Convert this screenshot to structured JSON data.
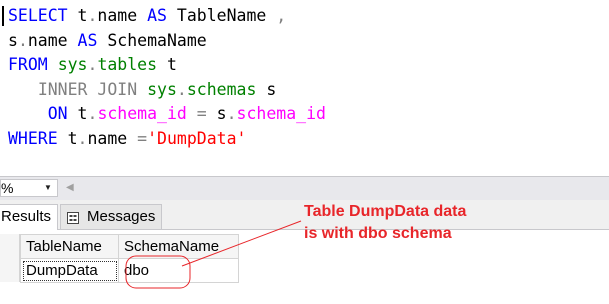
{
  "editor": {
    "lines": [
      [
        {
          "t": "SELECT",
          "c": "kw"
        },
        {
          "t": " t",
          "c": ""
        },
        {
          "t": ".",
          "c": "gr"
        },
        {
          "t": "name ",
          "c": ""
        },
        {
          "t": "AS",
          "c": "kw"
        },
        {
          "t": " TableName ",
          "c": ""
        },
        {
          "t": ",",
          "c": "gr"
        }
      ],
      [
        {
          "t": "s",
          "c": ""
        },
        {
          "t": ".",
          "c": "gr"
        },
        {
          "t": "name ",
          "c": ""
        },
        {
          "t": "AS",
          "c": "kw"
        },
        {
          "t": " SchemaName",
          "c": ""
        }
      ],
      [
        {
          "t": "FROM",
          "c": "kw"
        },
        {
          "t": " ",
          "c": ""
        },
        {
          "t": "sys",
          "c": "sy"
        },
        {
          "t": ".",
          "c": "gr"
        },
        {
          "t": "tables",
          "c": "sy"
        },
        {
          "t": " t",
          "c": ""
        }
      ],
      [
        {
          "t": "   ",
          "c": ""
        },
        {
          "t": "INNER JOIN",
          "c": "gr"
        },
        {
          "t": " ",
          "c": ""
        },
        {
          "t": "sys",
          "c": "sy"
        },
        {
          "t": ".",
          "c": "gr"
        },
        {
          "t": "schemas",
          "c": "sy"
        },
        {
          "t": " s",
          "c": ""
        }
      ],
      [
        {
          "t": "    ",
          "c": ""
        },
        {
          "t": "ON",
          "c": "kw"
        },
        {
          "t": " t",
          "c": ""
        },
        {
          "t": ".",
          "c": "gr"
        },
        {
          "t": "schema_id",
          "c": "pk"
        },
        {
          "t": " ",
          "c": ""
        },
        {
          "t": "=",
          "c": "gr"
        },
        {
          "t": " s",
          "c": ""
        },
        {
          "t": ".",
          "c": "gr"
        },
        {
          "t": "schema_id",
          "c": "pk"
        }
      ],
      [
        {
          "t": "WHERE",
          "c": "kw"
        },
        {
          "t": " t",
          "c": ""
        },
        {
          "t": ".",
          "c": "gr"
        },
        {
          "t": "name ",
          "c": ""
        },
        {
          "t": "=",
          "c": "gr"
        },
        {
          "t": "'DumpData'",
          "c": "str"
        }
      ]
    ]
  },
  "zoom": {
    "value": "%",
    "arrow": "▼",
    "scroll_arrow": "◀"
  },
  "tabs": {
    "results_label": "Results",
    "messages_label": "Messages"
  },
  "grid": {
    "columns": [
      "TableName",
      "SchemaName"
    ],
    "rows": [
      [
        "DumpData",
        "dbo"
      ]
    ]
  },
  "annotation": {
    "line1": "Table DumpData data",
    "line2": "is with dbo schema",
    "color": "#e8262a"
  },
  "colors": {
    "keyword": "#0000ff",
    "operator": "#808080",
    "system_object": "#008000",
    "string": "#ff0000",
    "column": "#ff00ff"
  },
  "icons": {
    "messages_tab": "messages-icon",
    "zoom_dropdown": "chevron-down-icon",
    "scroll": "scroll-left-icon"
  }
}
